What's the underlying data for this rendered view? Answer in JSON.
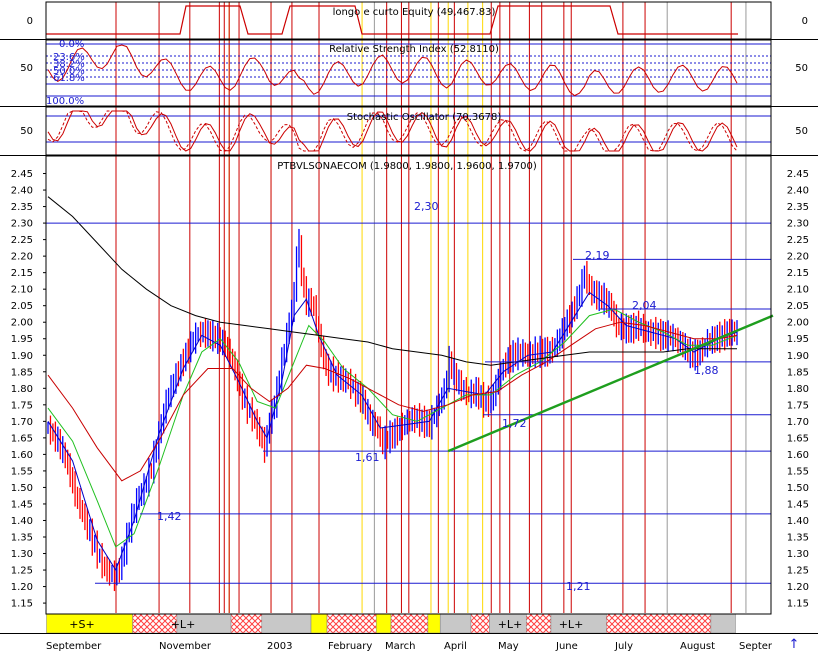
{
  "colors": {
    "background": "#ffffff",
    "frame": "#000000",
    "blue_lines": "#1a1ad0",
    "red_lines": "#cc0000",
    "yellow_lines": "#ffd800",
    "trend": "#1e9e1e",
    "bar_up": "#0000ff",
    "bar_down": "#ff0000",
    "ma_blue": "#0000c8",
    "ma_green": "#20c020",
    "ma_red": "#c80000",
    "ma_black": "#000000",
    "strip_yellow": "#ffff00",
    "strip_gray": "#c8c8c8",
    "strip_hatch": "#ff4040"
  },
  "panels": {
    "volume": {
      "title": "longo e curto Equity (49,467.83)",
      "axis_left": [
        "0"
      ],
      "axis_right": [
        "0"
      ]
    },
    "rsi": {
      "title": "Relative Strength Index (52.8110)",
      "axis_left": [
        "50"
      ],
      "axis_right": [
        "50"
      ],
      "fib_labels": [
        "0.0%",
        "23.6%",
        "38.2%",
        "50.0%",
        "61.8%",
        "100.0%"
      ]
    },
    "stochastic": {
      "title": "Stochastic Oscillator (70.3678)",
      "axis_left": [
        "50"
      ],
      "axis_right": [
        "50"
      ]
    },
    "price": {
      "title": "PTBVLSONAECOM (1.9800, 1.9800, 1.9600, 1.9700)"
    }
  },
  "annotations": [
    "2,30",
    "2,19",
    "2,04",
    "1,88",
    "1,72",
    "1,61",
    "1,42",
    "1,21"
  ],
  "strip_labels": [
    "+S+",
    "+L+",
    "+L+",
    "+L+"
  ],
  "x_labels": [
    "September",
    "November",
    "2003",
    "February",
    "March",
    "April",
    "May",
    "June",
    "July",
    "August",
    "Septer"
  ],
  "nav_arrow": "↑",
  "chart_data": {
    "type": "bar",
    "title": "PTBVLSONAECOM (1.9800, 1.9800, 1.9600, 1.9700)",
    "ylim": [
      1.12,
      2.5
    ],
    "yticks": [
      "1.15",
      "1.20",
      "1.25",
      "1.30",
      "1.35",
      "1.40",
      "1.45",
      "1.50",
      "1.55",
      "1.60",
      "1.65",
      "1.70",
      "1.75",
      "1.80",
      "1.85",
      "1.90",
      "1.95",
      "2.00",
      "2.05",
      "2.10",
      "2.15",
      "2.20",
      "2.25",
      "2.30",
      "2.35",
      "2.40",
      "2.45"
    ],
    "close_path": [
      [
        0,
        1.68
      ],
      [
        8,
        1.64
      ],
      [
        15,
        1.58
      ],
      [
        22,
        1.48
      ],
      [
        30,
        1.4
      ],
      [
        38,
        1.32
      ],
      [
        45,
        1.26
      ],
      [
        50,
        1.24
      ],
      [
        55,
        1.23
      ],
      [
        60,
        1.28
      ],
      [
        66,
        1.38
      ],
      [
        72,
        1.46
      ],
      [
        78,
        1.5
      ],
      [
        84,
        1.56
      ],
      [
        90,
        1.66
      ],
      [
        96,
        1.76
      ],
      [
        102,
        1.82
      ],
      [
        108,
        1.87
      ],
      [
        114,
        1.92
      ],
      [
        120,
        1.96
      ],
      [
        126,
        1.97
      ],
      [
        132,
        1.96
      ],
      [
        138,
        1.95
      ],
      [
        144,
        1.93
      ],
      [
        150,
        1.88
      ],
      [
        156,
        1.8
      ],
      [
        162,
        1.74
      ],
      [
        168,
        1.7
      ],
      [
        172,
        1.66
      ],
      [
        176,
        1.62
      ],
      [
        180,
        1.7
      ],
      [
        185,
        1.77
      ],
      [
        190,
        1.88
      ],
      [
        195,
        1.98
      ],
      [
        200,
        2.08
      ],
      [
        203,
        2.28
      ],
      [
        206,
        2.14
      ],
      [
        210,
        2.06
      ],
      [
        215,
        2.06
      ],
      [
        220,
        1.96
      ],
      [
        226,
        1.86
      ],
      [
        232,
        1.84
      ],
      [
        238,
        1.83
      ],
      [
        244,
        1.82
      ],
      [
        250,
        1.79
      ],
      [
        256,
        1.76
      ],
      [
        262,
        1.7
      ],
      [
        268,
        1.68
      ],
      [
        272,
        1.63
      ],
      [
        276,
        1.65
      ],
      [
        280,
        1.66
      ],
      [
        286,
        1.68
      ],
      [
        292,
        1.7
      ],
      [
        298,
        1.71
      ],
      [
        304,
        1.7
      ],
      [
        310,
        1.69
      ],
      [
        316,
        1.74
      ],
      [
        322,
        1.79
      ],
      [
        326,
        1.88
      ],
      [
        330,
        1.84
      ],
      [
        336,
        1.8
      ],
      [
        342,
        1.78
      ],
      [
        348,
        1.79
      ],
      [
        354,
        1.76
      ],
      [
        360,
        1.76
      ],
      [
        366,
        1.83
      ],
      [
        372,
        1.88
      ],
      [
        378,
        1.9
      ],
      [
        384,
        1.91
      ],
      [
        390,
        1.9
      ],
      [
        396,
        1.91
      ],
      [
        402,
        1.91
      ],
      [
        408,
        1.91
      ],
      [
        414,
        1.94
      ],
      [
        420,
        1.99
      ],
      [
        426,
        2.03
      ],
      [
        432,
        2.09
      ],
      [
        436,
        2.15
      ],
      [
        440,
        2.1
      ],
      [
        446,
        2.08
      ],
      [
        452,
        2.07
      ],
      [
        458,
        2.04
      ],
      [
        462,
        1.99
      ],
      [
        468,
        1.98
      ],
      [
        474,
        1.98
      ],
      [
        480,
        1.99
      ],
      [
        486,
        1.97
      ],
      [
        492,
        1.97
      ],
      [
        498,
        1.96
      ],
      [
        504,
        1.96
      ],
      [
        510,
        1.95
      ],
      [
        516,
        1.93
      ],
      [
        520,
        1.91
      ],
      [
        524,
        1.9
      ],
      [
        530,
        1.91
      ],
      [
        536,
        1.94
      ],
      [
        542,
        1.95
      ],
      [
        548,
        1.96
      ],
      [
        554,
        1.97
      ],
      [
        560,
        1.97
      ]
    ],
    "series": [
      {
        "name": "",
        "color": "#0000c8",
        "values": [
          [
            0,
            1.7
          ],
          [
            20,
            1.58
          ],
          [
            40,
            1.34
          ],
          [
            55,
            1.25
          ],
          [
            70,
            1.4
          ],
          [
            90,
            1.66
          ],
          [
            110,
            1.86
          ],
          [
            125,
            1.96
          ],
          [
            140,
            1.93
          ],
          [
            155,
            1.82
          ],
          [
            170,
            1.7
          ],
          [
            178,
            1.65
          ],
          [
            190,
            1.82
          ],
          [
            200,
            2.02
          ],
          [
            210,
            2.07
          ],
          [
            220,
            1.96
          ],
          [
            235,
            1.84
          ],
          [
            255,
            1.78
          ],
          [
            270,
            1.68
          ],
          [
            290,
            1.69
          ],
          [
            310,
            1.7
          ],
          [
            325,
            1.8
          ],
          [
            340,
            1.79
          ],
          [
            355,
            1.78
          ],
          [
            370,
            1.85
          ],
          [
            390,
            1.9
          ],
          [
            410,
            1.91
          ],
          [
            425,
            2.0
          ],
          [
            440,
            2.09
          ],
          [
            455,
            2.05
          ],
          [
            470,
            1.99
          ],
          [
            490,
            1.97
          ],
          [
            510,
            1.95
          ],
          [
            525,
            1.91
          ],
          [
            545,
            1.95
          ],
          [
            560,
            1.97
          ]
        ]
      },
      {
        "name": "",
        "color": "#20c020",
        "values": [
          [
            0,
            1.74
          ],
          [
            20,
            1.64
          ],
          [
            40,
            1.46
          ],
          [
            55,
            1.32
          ],
          [
            70,
            1.36
          ],
          [
            90,
            1.56
          ],
          [
            110,
            1.78
          ],
          [
            125,
            1.91
          ],
          [
            140,
            1.95
          ],
          [
            155,
            1.88
          ],
          [
            170,
            1.76
          ],
          [
            185,
            1.74
          ],
          [
            200,
            1.88
          ],
          [
            212,
            1.99
          ],
          [
            225,
            1.94
          ],
          [
            240,
            1.86
          ],
          [
            260,
            1.8
          ],
          [
            280,
            1.72
          ],
          [
            300,
            1.7
          ],
          [
            320,
            1.74
          ],
          [
            340,
            1.78
          ],
          [
            360,
            1.78
          ],
          [
            380,
            1.84
          ],
          [
            400,
            1.88
          ],
          [
            420,
            1.94
          ],
          [
            440,
            2.02
          ],
          [
            460,
            2.04
          ],
          [
            480,
            2.0
          ],
          [
            500,
            1.97
          ],
          [
            520,
            1.93
          ],
          [
            540,
            1.93
          ],
          [
            560,
            1.96
          ]
        ]
      },
      {
        "name": "",
        "color": "#c80000",
        "values": [
          [
            0,
            1.84
          ],
          [
            20,
            1.74
          ],
          [
            40,
            1.62
          ],
          [
            60,
            1.52
          ],
          [
            75,
            1.55
          ],
          [
            90,
            1.64
          ],
          [
            110,
            1.78
          ],
          [
            130,
            1.86
          ],
          [
            150,
            1.86
          ],
          [
            165,
            1.8
          ],
          [
            180,
            1.76
          ],
          [
            195,
            1.8
          ],
          [
            210,
            1.87
          ],
          [
            225,
            1.86
          ],
          [
            245,
            1.83
          ],
          [
            265,
            1.79
          ],
          [
            285,
            1.75
          ],
          [
            305,
            1.73
          ],
          [
            325,
            1.75
          ],
          [
            345,
            1.78
          ],
          [
            365,
            1.79
          ],
          [
            385,
            1.84
          ],
          [
            405,
            1.88
          ],
          [
            425,
            1.93
          ],
          [
            445,
            1.98
          ],
          [
            465,
            2.0
          ],
          [
            485,
            1.99
          ],
          [
            505,
            1.97
          ],
          [
            525,
            1.95
          ],
          [
            545,
            1.95
          ],
          [
            560,
            1.96
          ]
        ]
      },
      {
        "name": "",
        "color": "#000000",
        "values": [
          [
            0,
            2.38
          ],
          [
            20,
            2.32
          ],
          [
            40,
            2.24
          ],
          [
            60,
            2.16
          ],
          [
            80,
            2.1
          ],
          [
            100,
            2.05
          ],
          [
            120,
            2.02
          ],
          [
            140,
            2.0
          ],
          [
            160,
            1.99
          ],
          [
            180,
            1.98
          ],
          [
            200,
            1.97
          ],
          [
            220,
            1.96
          ],
          [
            240,
            1.95
          ],
          [
            260,
            1.94
          ],
          [
            280,
            1.92
          ],
          [
            300,
            1.91
          ],
          [
            320,
            1.9
          ],
          [
            340,
            1.88
          ],
          [
            360,
            1.87
          ],
          [
            380,
            1.88
          ],
          [
            400,
            1.89
          ],
          [
            420,
            1.9
          ],
          [
            440,
            1.91
          ],
          [
            460,
            1.91
          ],
          [
            480,
            1.91
          ],
          [
            500,
            1.91
          ],
          [
            520,
            1.92
          ],
          [
            540,
            1.92
          ],
          [
            560,
            1.92
          ]
        ]
      }
    ],
    "h_levels": [
      2.3,
      2.19,
      2.04,
      1.88,
      1.72,
      1.61,
      1.42,
      1.21
    ],
    "trend": {
      "from": [
        270,
        1.61
      ],
      "to": [
        560,
        1.98
      ]
    },
    "red_verticals": [
      0,
      35,
      60,
      84,
      88,
      92,
      100,
      126,
      143,
      165,
      220,
      232,
      238,
      262,
      275,
      305,
      312,
      320,
      336,
      346,
      364,
      370,
      412,
      430,
      500
    ],
    "yellow_verticals": [
      92,
      126,
      200,
      256,
      270,
      286,
      298
    ],
    "gray_verticals": [
      210,
      448,
      512,
      545
    ],
    "strip": [
      {
        "type": "yellow",
        "from": 0,
        "to": 70,
        "label": "+S+"
      },
      {
        "type": "hatch",
        "from": 70,
        "to": 106,
        "label": ""
      },
      {
        "type": "gray",
        "from": 106,
        "to": 150,
        "label": "+L+"
      },
      {
        "type": "hatch",
        "from": 150,
        "to": 175,
        "label": ""
      },
      {
        "type": "gray",
        "from": 175,
        "to": 215,
        "label": ""
      },
      {
        "type": "yellow",
        "from": 215,
        "to": 228,
        "label": ""
      },
      {
        "type": "hatch",
        "from": 228,
        "to": 268,
        "label": ""
      },
      {
        "type": "yellow",
        "from": 268,
        "to": 280,
        "label": ""
      },
      {
        "type": "hatch",
        "from": 280,
        "to": 310,
        "label": ""
      },
      {
        "type": "yellow",
        "from": 310,
        "to": 320,
        "label": ""
      },
      {
        "type": "gray",
        "from": 320,
        "to": 345,
        "label": ""
      },
      {
        "type": "hatch",
        "from": 345,
        "to": 360,
        "label": ""
      },
      {
        "type": "gray",
        "from": 360,
        "to": 390,
        "label": "+L+"
      },
      {
        "type": "hatch",
        "from": 390,
        "to": 410,
        "label": ""
      },
      {
        "type": "gray",
        "from": 410,
        "to": 455,
        "label": "+L+"
      },
      {
        "type": "hatch",
        "from": 455,
        "to": 540,
        "label": ""
      },
      {
        "type": "gray",
        "from": 540,
        "to": 560,
        "label": ""
      }
    ]
  }
}
